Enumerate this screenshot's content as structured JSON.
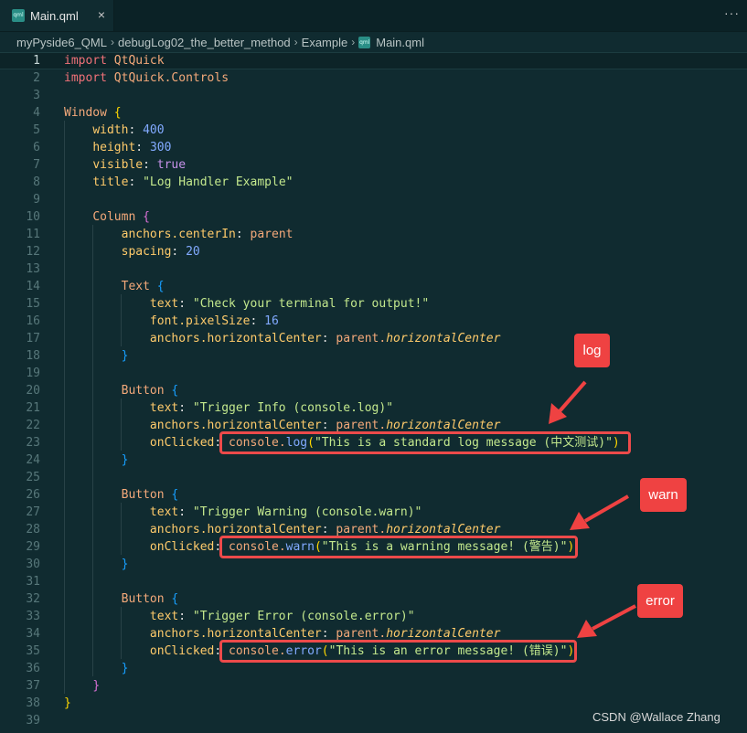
{
  "tab": {
    "icon": "qml-file-icon",
    "icon_text": "qml",
    "label": "Main.qml",
    "close": "×"
  },
  "menu_more": "···",
  "breadcrumb": [
    "myPyside6_QML",
    "debugLog02_the_better_method",
    "Example",
    "Main.qml"
  ],
  "active_line": 1,
  "code_lines": [
    [
      [
        "import ",
        "kw"
      ],
      [
        "QtQuick",
        "type"
      ]
    ],
    [
      [
        "import ",
        "kw"
      ],
      [
        "QtQuick.Controls",
        "type"
      ]
    ],
    [],
    [
      [
        "Window ",
        "type"
      ],
      [
        "{",
        "brace1"
      ]
    ],
    [
      [
        "    width",
        "prop"
      ],
      [
        ": ",
        "plain"
      ],
      [
        "400",
        "num"
      ]
    ],
    [
      [
        "    height",
        "prop"
      ],
      [
        ": ",
        "plain"
      ],
      [
        "300",
        "num"
      ]
    ],
    [
      [
        "    visible",
        "prop"
      ],
      [
        ": ",
        "plain"
      ],
      [
        "true",
        "bool"
      ]
    ],
    [
      [
        "    title",
        "prop"
      ],
      [
        ": ",
        "plain"
      ],
      [
        "\"Log Handler Example\"",
        "str"
      ]
    ],
    [],
    [
      [
        "    Column ",
        "type"
      ],
      [
        "{",
        "brace2"
      ]
    ],
    [
      [
        "        anchors.centerIn",
        "prop"
      ],
      [
        ": ",
        "plain"
      ],
      [
        "parent",
        "type"
      ]
    ],
    [
      [
        "        spacing",
        "prop"
      ],
      [
        ": ",
        "plain"
      ],
      [
        "20",
        "num"
      ]
    ],
    [],
    [
      [
        "        Text ",
        "type"
      ],
      [
        "{",
        "brace3"
      ]
    ],
    [
      [
        "            text",
        "prop"
      ],
      [
        ": ",
        "plain"
      ],
      [
        "\"Check your terminal for output!\"",
        "str"
      ]
    ],
    [
      [
        "            font.pixelSize",
        "prop"
      ],
      [
        ": ",
        "plain"
      ],
      [
        "16",
        "num"
      ]
    ],
    [
      [
        "            anchors.horizontalCenter",
        "prop"
      ],
      [
        ": ",
        "plain"
      ],
      [
        "parent.",
        "type"
      ],
      [
        "horizontalCenter",
        "ital"
      ]
    ],
    [
      [
        "        }",
        "brace3"
      ]
    ],
    [],
    [
      [
        "        Button ",
        "type"
      ],
      [
        "{",
        "brace3"
      ]
    ],
    [
      [
        "            text",
        "prop"
      ],
      [
        ": ",
        "plain"
      ],
      [
        "\"Trigger Info (console.log)\"",
        "str"
      ]
    ],
    [
      [
        "            anchors.horizontalCenter",
        "prop"
      ],
      [
        ": ",
        "plain"
      ],
      [
        "parent.",
        "type"
      ],
      [
        "horizontalCenter",
        "ital"
      ]
    ],
    [
      [
        "            onClicked",
        "prop"
      ],
      [
        ": ",
        "plain"
      ],
      [
        "console.",
        "type"
      ],
      [
        "log",
        "fn"
      ],
      [
        "(",
        "brace1"
      ],
      [
        "\"This is a standard log message (中文测试)\"",
        "str"
      ],
      [
        ")",
        "brace1"
      ]
    ],
    [
      [
        "        }",
        "brace3"
      ]
    ],
    [],
    [
      [
        "        Button ",
        "type"
      ],
      [
        "{",
        "brace3"
      ]
    ],
    [
      [
        "            text",
        "prop"
      ],
      [
        ": ",
        "plain"
      ],
      [
        "\"Trigger Warning (console.warn)\"",
        "str"
      ]
    ],
    [
      [
        "            anchors.horizontalCenter",
        "prop"
      ],
      [
        ": ",
        "plain"
      ],
      [
        "parent.",
        "type"
      ],
      [
        "horizontalCenter",
        "ital"
      ]
    ],
    [
      [
        "            onClicked",
        "prop"
      ],
      [
        ": ",
        "plain"
      ],
      [
        "console.",
        "type"
      ],
      [
        "warn",
        "fn"
      ],
      [
        "(",
        "brace1"
      ],
      [
        "\"This is a warning message! (警告)\"",
        "str"
      ],
      [
        ")",
        "brace1"
      ]
    ],
    [
      [
        "        }",
        "brace3"
      ]
    ],
    [],
    [
      [
        "        Button ",
        "type"
      ],
      [
        "{",
        "brace3"
      ]
    ],
    [
      [
        "            text",
        "prop"
      ],
      [
        ": ",
        "plain"
      ],
      [
        "\"Trigger Error (console.error)\"",
        "str"
      ]
    ],
    [
      [
        "            anchors.horizontalCenter",
        "prop"
      ],
      [
        ": ",
        "plain"
      ],
      [
        "parent.",
        "type"
      ],
      [
        "horizontalCenter",
        "ital"
      ]
    ],
    [
      [
        "            onClicked",
        "prop"
      ],
      [
        ": ",
        "plain"
      ],
      [
        "console.",
        "type"
      ],
      [
        "error",
        "fn"
      ],
      [
        "(",
        "brace1"
      ],
      [
        "\"This is an error message! (错误)\"",
        "str"
      ],
      [
        ")",
        "brace1"
      ]
    ],
    [
      [
        "        }",
        "brace3"
      ]
    ],
    [
      [
        "    }",
        "brace2"
      ]
    ],
    [
      [
        "}",
        "brace1"
      ]
    ],
    []
  ],
  "callouts": {
    "log": "log",
    "warn": "warn",
    "error": "error"
  },
  "annotation_color": "#ef4242",
  "watermark": "CSDN @Wallace  Zhang"
}
